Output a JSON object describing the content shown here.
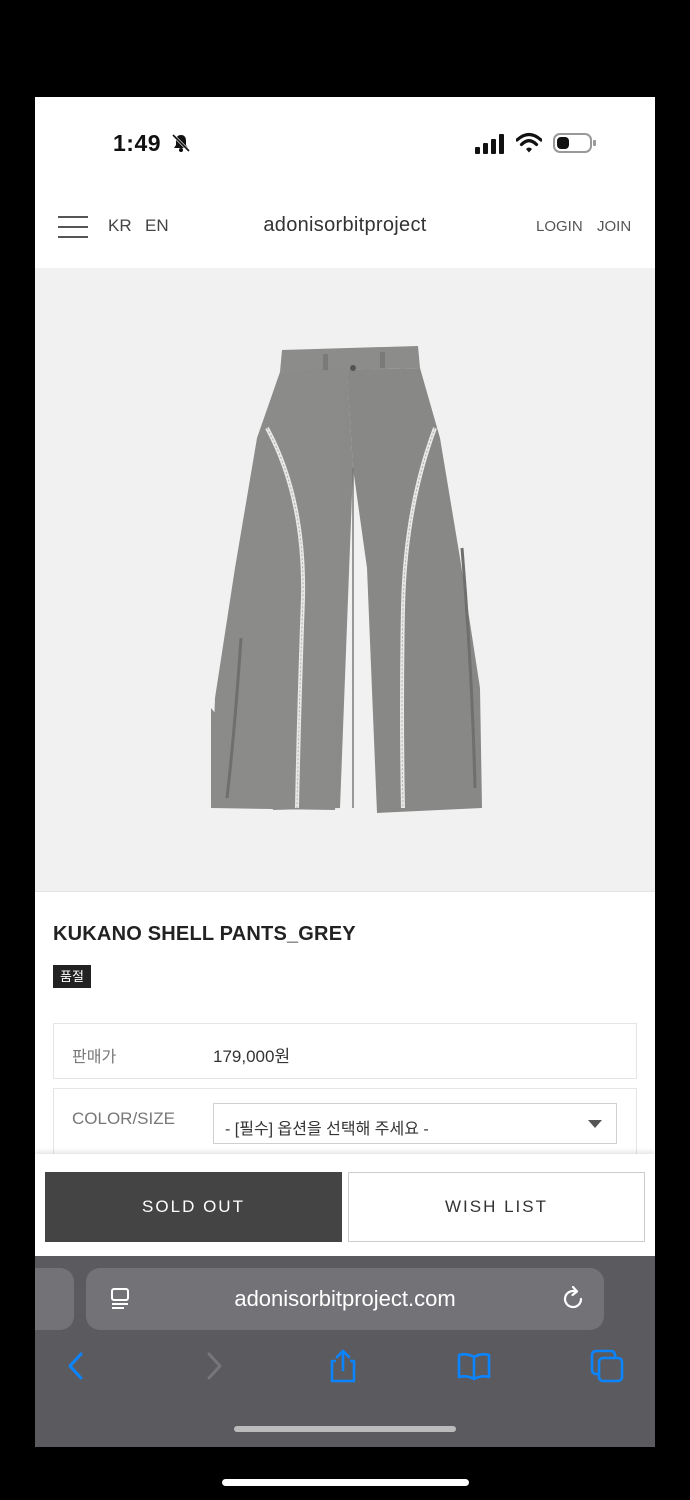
{
  "status_bar": {
    "time": "1:49"
  },
  "header": {
    "lang_kr": "KR",
    "lang_en": "EN",
    "brand": "adonisorbitproject",
    "login": "LOGIN",
    "join": "JOIN"
  },
  "product": {
    "name": "KUKANO SHELL PANTS_GREY",
    "badge": "품절",
    "price_label": "판매가",
    "price_value": "179,000원",
    "option_label": "COLOR/SIZE",
    "option_placeholder": "- [필수] 옵션을 선택해 주세요 -"
  },
  "actions": {
    "sold_out": "SOLD OUT",
    "wish_list": "WISH LIST"
  },
  "browser": {
    "url": "adonisorbitproject.com"
  },
  "colors": {
    "sold_out_button": "#444444",
    "safari_toolbar": "#5b5b5f",
    "safari_accent": "#0a84ff",
    "pants": "#8a8a88"
  },
  "icons": [
    "bell-slash-icon",
    "signal-icon",
    "wifi-icon",
    "battery-icon",
    "hamburger-menu-icon",
    "reader-icon",
    "reload-icon",
    "back-arrow-icon",
    "forward-arrow-icon",
    "share-icon",
    "bookmarks-icon",
    "tabs-icon"
  ]
}
